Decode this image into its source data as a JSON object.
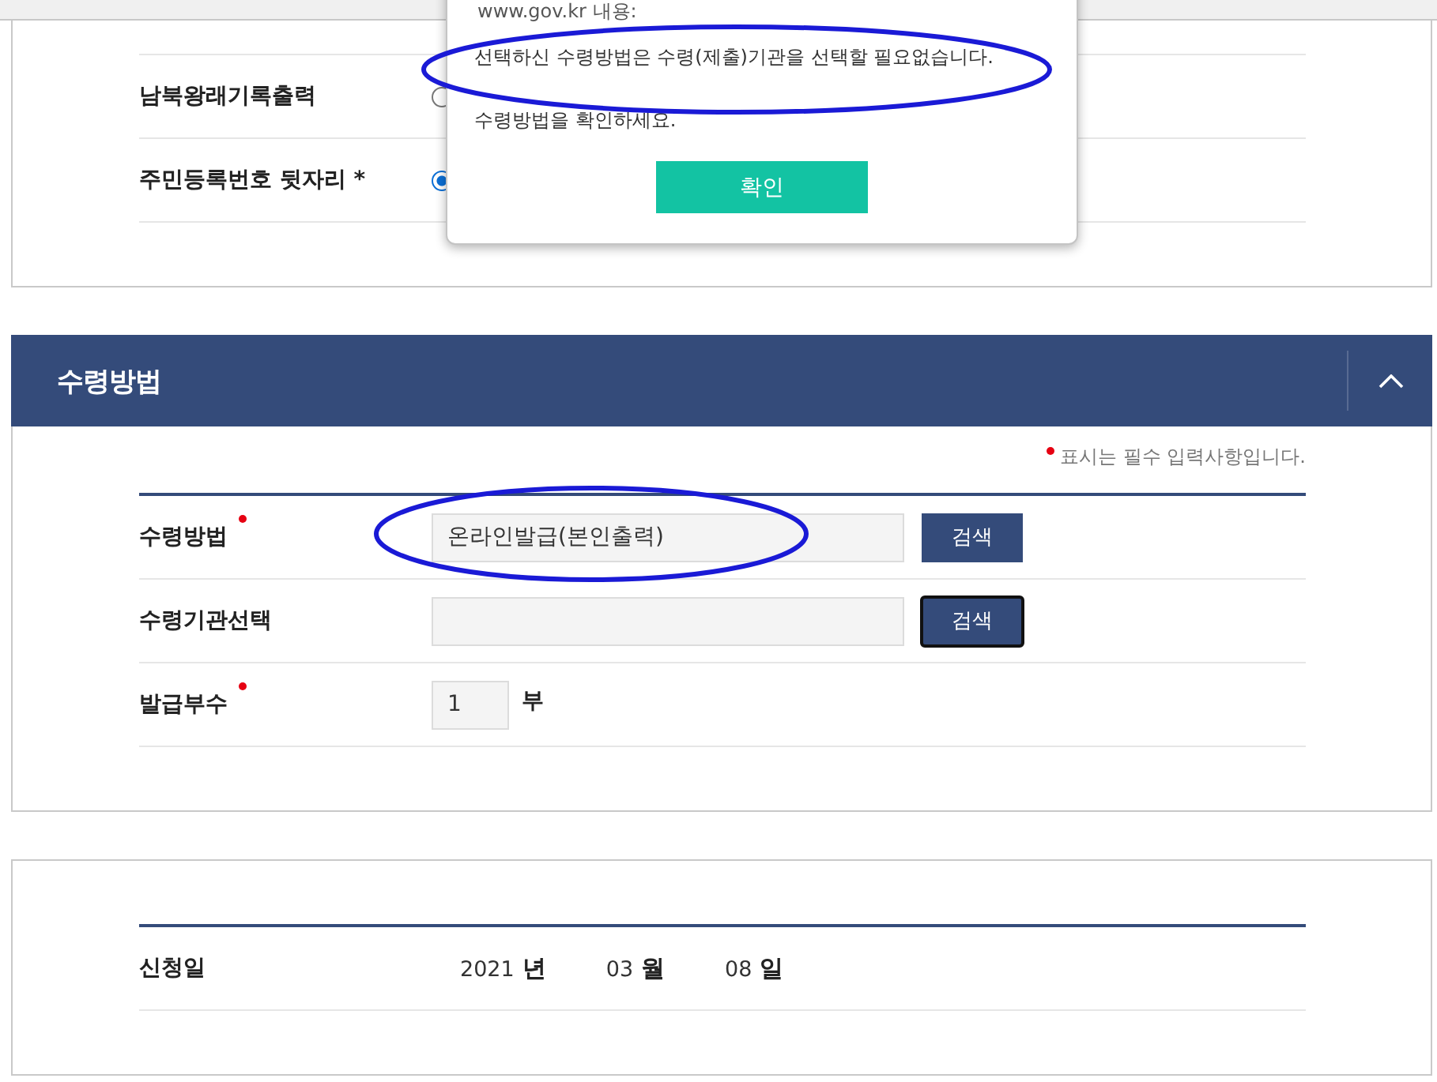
{
  "personal_rows": [
    {
      "label": "남북왕래기록출력",
      "radio": {
        "selected": false
      }
    },
    {
      "label": "주민등록번호 뒷자리 *",
      "radio": {
        "selected": true
      }
    }
  ],
  "dialog": {
    "origin": "www.gov.kr 내용:",
    "message": "선택하신 수령방법은 수령(제출)기관을 선택할 필요없습니다.",
    "note": "수령방법을 확인하세요.",
    "button": "확인"
  },
  "section": {
    "title": "수령방법",
    "expanded": true,
    "required_note": "표시는 필수 입력사항입니다.",
    "fields": [
      {
        "kind": "search",
        "label": "수령방법",
        "required": true,
        "value": "온라인발급(본인출력)",
        "button": "검색",
        "focused": false
      },
      {
        "kind": "search",
        "label": "수령기관선택",
        "required": false,
        "button": "검색",
        "focused": true
      },
      {
        "kind": "count",
        "label": "발급부수",
        "required": true,
        "value": "1",
        "unit": "부"
      }
    ]
  },
  "application_date": {
    "label": "신청일",
    "parts": [
      {
        "value": "2021",
        "unit": "년"
      },
      {
        "value": "03",
        "unit": "월"
      },
      {
        "value": "08",
        "unit": "일"
      }
    ]
  }
}
